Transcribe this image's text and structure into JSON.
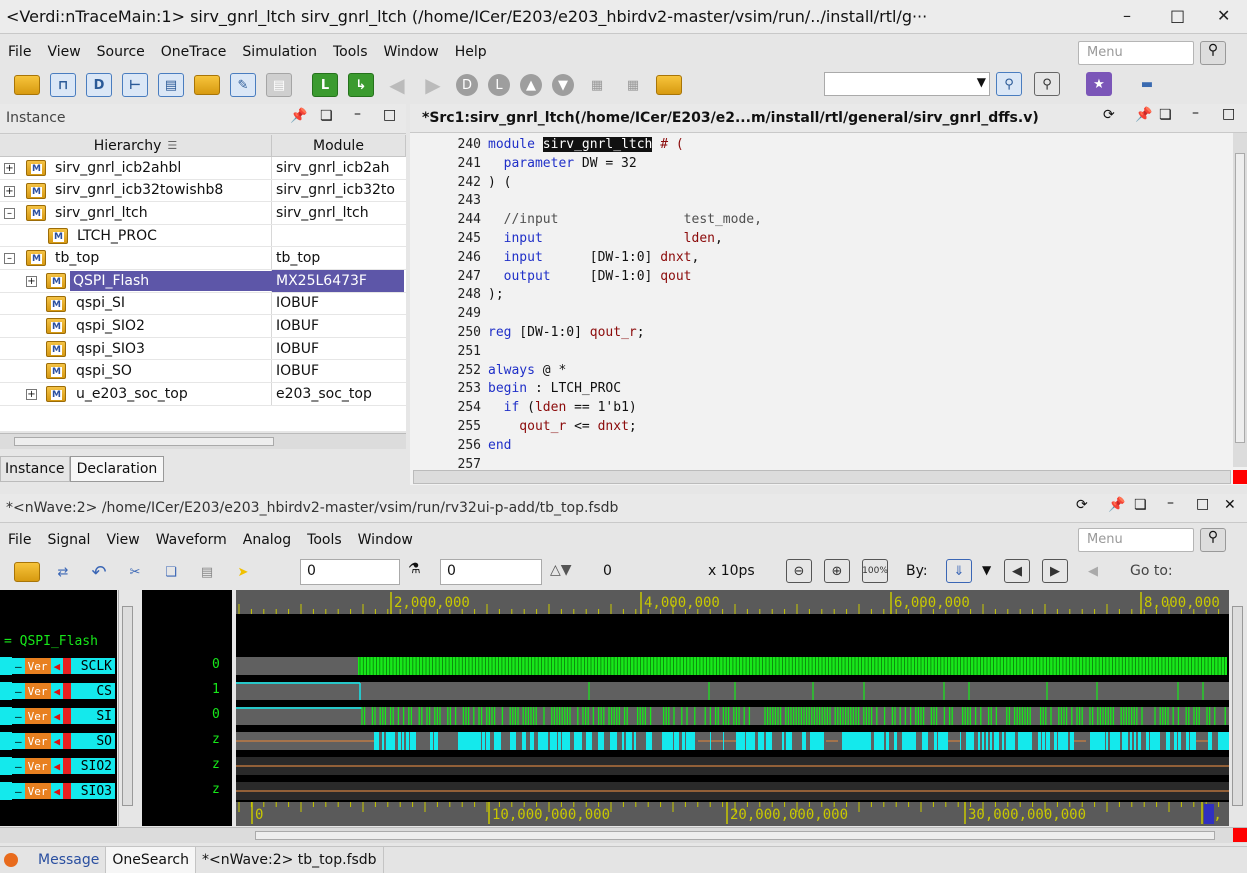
{
  "window": {
    "title": "<Verdi:nTraceMain:1> sirv_gnrl_ltch sirv_gnrl_ltch (/home/ICer/E203/e203_hbirdv2-master/vsim/run/../install/rtl/g···",
    "min": "–",
    "max": "□",
    "close": "✕"
  },
  "menu1": [
    "File",
    "View",
    "Source",
    "OneTrace",
    "Simulation",
    "Tools",
    "Window",
    "Help"
  ],
  "menu_search_placeholder": "Menu",
  "instance_panel": {
    "title": "Instance",
    "col_hierarchy": "Hierarchy",
    "col_module": "Module",
    "rows": [
      {
        "name": "sirv_gnrl_icb2ahbl",
        "module": "sirv_gnrl_icb2ah"
      },
      {
        "name": "sirv_gnrl_icb32towishb8",
        "module": "sirv_gnrl_icb32to"
      },
      {
        "name": "sirv_gnrl_ltch",
        "module": "sirv_gnrl_ltch"
      },
      {
        "name": "LTCH_PROC",
        "module": ""
      },
      {
        "name": "tb_top",
        "module": "tb_top"
      },
      {
        "name": "QSPI_Flash",
        "module": "MX25L6473F"
      },
      {
        "name": "qspi_SI",
        "module": "IOBUF"
      },
      {
        "name": "qspi_SIO2",
        "module": "IOBUF"
      },
      {
        "name": "qspi_SIO3",
        "module": "IOBUF"
      },
      {
        "name": "qspi_SO",
        "module": "IOBUF"
      },
      {
        "name": "u_e203_soc_top",
        "module": "e203_soc_top"
      }
    ],
    "tab_instance": "Instance",
    "tab_declaration": "Declaration"
  },
  "source_panel": {
    "title": "*Src1:sirv_gnrl_ltch(/home/ICer/E203/e2...m/install/rtl/general/sirv_gnrl_dffs.v)",
    "lines": [
      {
        "n": "240",
        "segs": [
          [
            "kw",
            "module "
          ],
          [
            "hl",
            "sirv_gnrl_ltch"
          ],
          [
            "",
            ""
          ],
          [
            "id",
            " # ("
          ]
        ]
      },
      {
        "n": "241",
        "segs": [
          [
            "kw",
            "  parameter"
          ],
          [
            "",
            " DW = 32"
          ]
        ]
      },
      {
        "n": "242",
        "segs": [
          [
            "",
            ") ("
          ]
        ]
      },
      {
        "n": "243",
        "segs": [
          [
            "",
            ""
          ]
        ]
      },
      {
        "n": "244",
        "segs": [
          [
            "cm",
            "  //input                test_mode,"
          ]
        ]
      },
      {
        "n": "245",
        "segs": [
          [
            "kw",
            "  input"
          ],
          [
            "",
            " "
          ],
          [
            "id",
            "                 lden"
          ],
          [
            "",
            ","
          ]
        ]
      },
      {
        "n": "246",
        "segs": [
          [
            "kw",
            "  input"
          ],
          [
            "",
            "      [DW-1:0] "
          ],
          [
            "id",
            "dnxt"
          ],
          [
            "",
            ","
          ]
        ]
      },
      {
        "n": "247",
        "segs": [
          [
            "kw",
            "  output"
          ],
          [
            "",
            "     [DW-1:0] "
          ],
          [
            "id",
            "qout"
          ]
        ]
      },
      {
        "n": "248",
        "segs": [
          [
            "",
            ");"
          ]
        ]
      },
      {
        "n": "249",
        "segs": [
          [
            "",
            ""
          ]
        ]
      },
      {
        "n": "250",
        "segs": [
          [
            "kw",
            "reg"
          ],
          [
            "",
            " [DW-1:0] "
          ],
          [
            "id",
            "qout_r"
          ],
          [
            "",
            ";"
          ]
        ]
      },
      {
        "n": "251",
        "segs": [
          [
            "",
            ""
          ]
        ]
      },
      {
        "n": "252",
        "segs": [
          [
            "kw",
            "always"
          ],
          [
            "",
            " @ *"
          ]
        ]
      },
      {
        "n": "253",
        "segs": [
          [
            "kw",
            "begin"
          ],
          [
            "",
            " : LTCH_PROC"
          ]
        ]
      },
      {
        "n": "254",
        "segs": [
          [
            "kw",
            "  if"
          ],
          [
            "",
            " ("
          ],
          [
            "id",
            "lden"
          ],
          [
            "",
            " == 1'b1)"
          ]
        ]
      },
      {
        "n": "255",
        "segs": [
          [
            "id",
            "    qout_r"
          ],
          [
            "",
            " <= "
          ],
          [
            "id",
            "dnxt"
          ],
          [
            "",
            ";"
          ]
        ]
      },
      {
        "n": "256",
        "segs": [
          [
            "kw",
            "end"
          ]
        ]
      },
      {
        "n": "257",
        "segs": [
          [
            "",
            ""
          ]
        ]
      }
    ]
  },
  "nwave": {
    "title": "*<nWave:2> /home/ICer/E203/e203_hbirdv2-master/vsim/run/rv32ui-p-add/tb_top.fsdb",
    "menu": [
      "File",
      "Signal",
      "View",
      "Waveform",
      "Analog",
      "Tools",
      "Window"
    ],
    "cursor_time": "0",
    "marker_time": "0",
    "delta": "0",
    "unit": "x 10ps",
    "by_label": "By:",
    "goto_label": "Go to:",
    "group": "= QSPI_Flash",
    "signals": [
      {
        "name": "SCLK",
        "value": "0"
      },
      {
        "name": "CS",
        "value": "1"
      },
      {
        "name": "SI",
        "value": "0"
      },
      {
        "name": "SO",
        "value": "z"
      },
      {
        "name": "SIO2",
        "value": "z"
      },
      {
        "name": "SIO3",
        "value": "z"
      }
    ],
    "ruler_top": [
      "2,000,000",
      "4,000,000",
      "6,000,000",
      "8,000,000"
    ],
    "ruler_bottom": [
      "0",
      "10,000,000,000",
      "20,000,000,000",
      "30,000,000,000",
      "0,"
    ],
    "tag_ver": "Ver",
    "colors": {
      "clk": "#17e81a",
      "cyan": "#14e9ec",
      "gray": "#606060",
      "orange": "#d08040",
      "ruler": "#c8c800"
    }
  },
  "bottom_tabs": [
    "Message",
    "OneSearch",
    "*<nWave:2> tb_top.fsdb"
  ]
}
